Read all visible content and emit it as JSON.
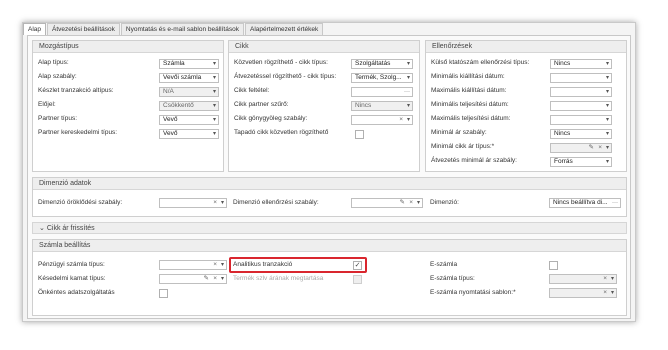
{
  "tabs": [
    {
      "label": "Alap"
    },
    {
      "label": "Átvezetési beállítások"
    },
    {
      "label": "Nyomtatás és e-mail sablon beállítások"
    },
    {
      "label": "Alapértelmezett értékek"
    }
  ],
  "mozgastipus": {
    "title": "Mozgástípus",
    "fields": [
      {
        "label": "Alap típus:",
        "value": "Számla"
      },
      {
        "label": "Alap szabály:",
        "value": "Vevői számla"
      },
      {
        "label": "Készlet tranzakció altípus:",
        "value": "N/A"
      },
      {
        "label": "Előjel:",
        "value": "Csökkentő"
      },
      {
        "label": "Partner típus:",
        "value": "Vevő"
      },
      {
        "label": "Partner kereskedelmi típus:",
        "value": "Vevő"
      }
    ]
  },
  "cikk": {
    "title": "Cikk",
    "fields": [
      {
        "label": "Közvetlen rögzíthető - cikk típus:",
        "value": "Szolgáltatás"
      },
      {
        "label": "Átvezetéssel rögzíthető - cikk típus:",
        "value": "Termék, Szolg..."
      },
      {
        "label": "Cikk feltétel:",
        "value": ""
      },
      {
        "label": "Cikk partner szűrő:",
        "value": "Nincs"
      },
      {
        "label": "Cikk gönygyöleg szabály:",
        "value": ""
      },
      {
        "label": "Tapadó cikk közvetlen rögzíthető",
        "value": ""
      }
    ]
  },
  "ellenorzesek": {
    "title": "Ellenőrzések",
    "fields": [
      {
        "label": "Külső ktatószám ellenőrzési típus:",
        "value": "Nincs"
      },
      {
        "label": "Minimális kiállítási dátum:",
        "value": ""
      },
      {
        "label": "Maximális kiállítási dátum:",
        "value": ""
      },
      {
        "label": "Minimális teljesítési dátum:",
        "value": ""
      },
      {
        "label": "Maximális teljesítési dátum:",
        "value": ""
      },
      {
        "label": "Minimál ár szabály:",
        "value": "Nincs"
      },
      {
        "label": "Minimál cikk ár típus:*",
        "value": ""
      },
      {
        "label": "Átvezetés minimál ár szabály:",
        "value": "Forrás"
      }
    ]
  },
  "dimenzio": {
    "title": "Dimenzió adatok",
    "oroklodesi_label": "Dimenzió öröklődési szabály:",
    "ellenorzesi_label": "Dimenzió ellenőrzési szabály:",
    "dimenzio_label": "Dimenzió:",
    "dimenzio_value": "Nincs beállítva di..."
  },
  "cikk_ar_label": "Cikk ár frissítés",
  "szamla": {
    "title": "Számla beállítás",
    "penzugyi_label": "Pénzügyi számla típus:",
    "kesedelmi_label": "Késedelmi kamat típus:",
    "onkentes_label": "Önkéntes adatszolgáltatás",
    "analitikus_label": "Analitikus tranzakció",
    "termek_label": "Termék szlv árának megtartása",
    "eszamla_label": "E-számla",
    "eszamla_tipus_label": "E-számla típus:",
    "eszamla_sablon_label": "E-számla nyomtatási sablon:*"
  },
  "colors": {
    "highlight": "#d9262e"
  }
}
